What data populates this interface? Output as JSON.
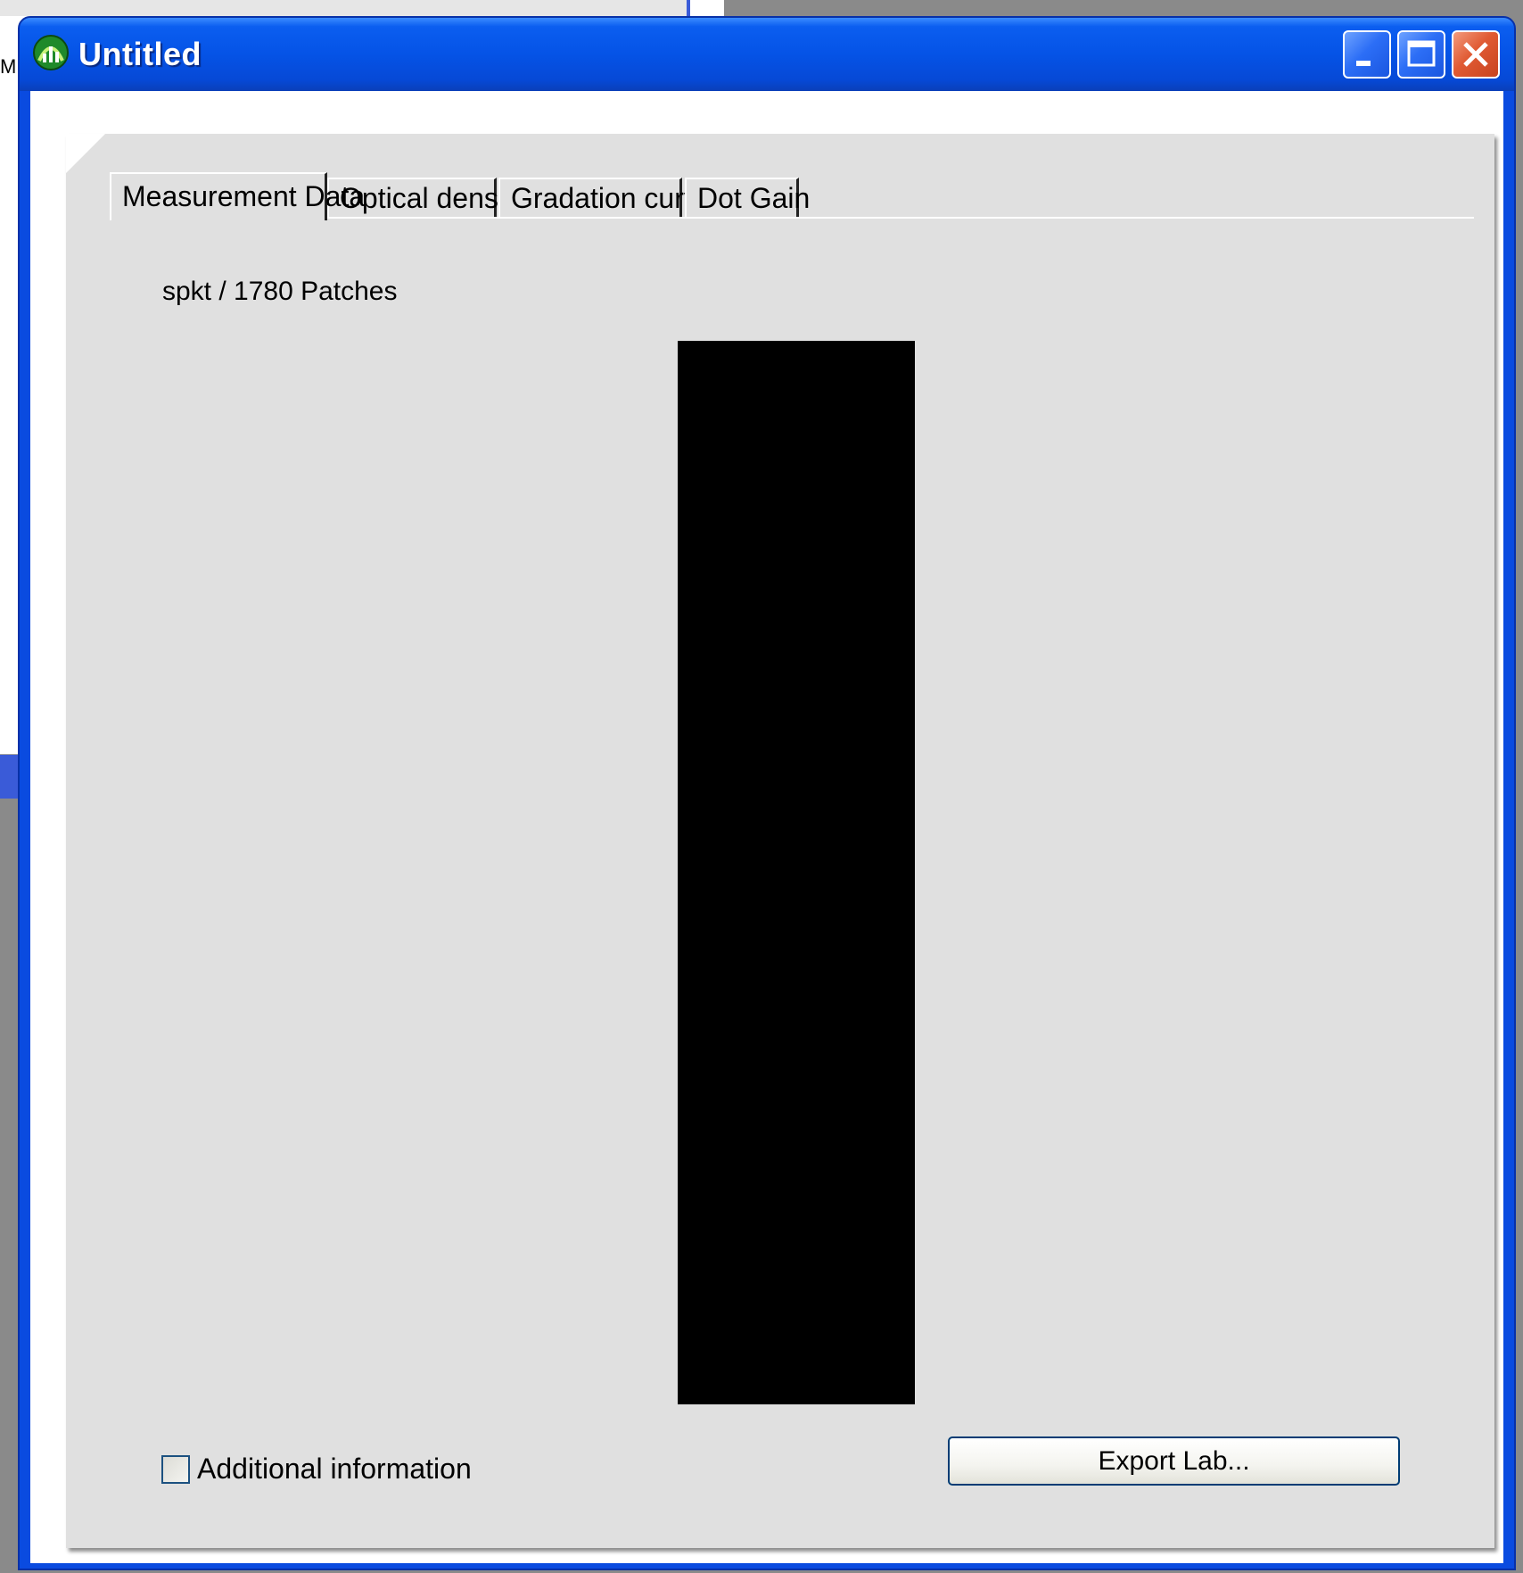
{
  "window": {
    "title": "Untitled"
  },
  "background": {
    "left_window_fragment": "M"
  },
  "tabs": [
    {
      "label": "Measurement Data",
      "active": true
    },
    {
      "label": "Optical density",
      "active": false
    },
    {
      "label": "Gradation curve",
      "active": false
    },
    {
      "label": "Dot Gain",
      "active": false
    }
  ],
  "content": {
    "patch_label": "spkt / 1780 Patches",
    "patch_color": "#000000"
  },
  "footer": {
    "checkbox_label": "Additional information",
    "checkbox_checked": false,
    "export_button_label": "Export Lab..."
  },
  "colors": {
    "titlebar_blue": "#0553e6",
    "close_red": "#e05a33",
    "panel_gray": "#e0e0e0"
  },
  "icons": {
    "app": "app-logo-icon",
    "minimize": "minimize-icon",
    "maximize": "maximize-icon",
    "close": "close-icon"
  }
}
